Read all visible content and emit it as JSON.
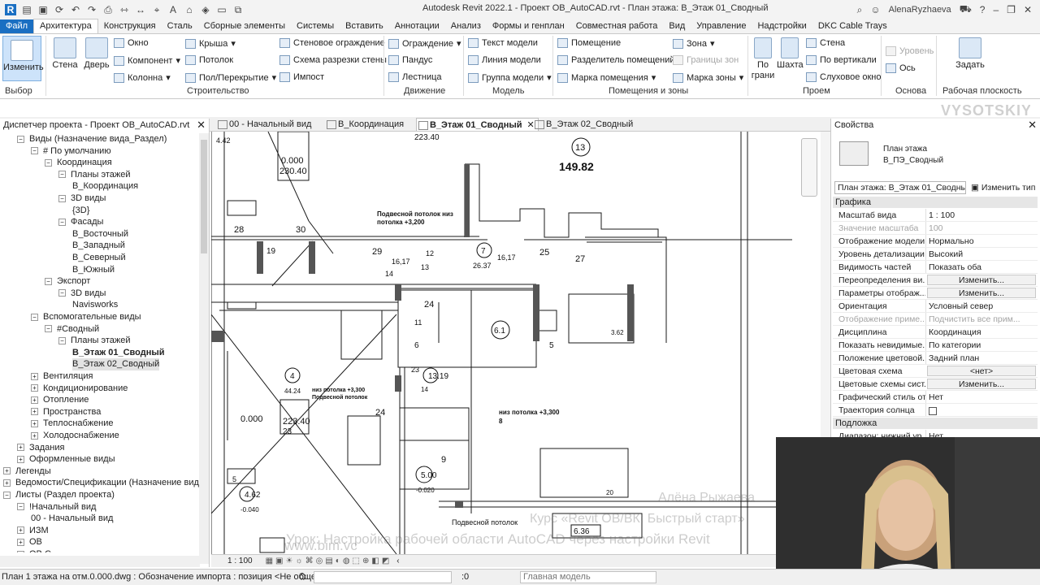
{
  "window": {
    "title": "Autodesk Revit 2022.1 - Проект OB_AutoCAD.rvt - План этажа: В_Этаж 01_Сводный",
    "user": "AlenaRyzhaeva"
  },
  "ribbon_tabs": [
    "Файл",
    "Архитектура",
    "Конструкция",
    "Сталь",
    "Сборные элементы",
    "Системы",
    "Вставить",
    "Аннотации",
    "Анализ",
    "Формы и генплан",
    "Совместная работа",
    "Вид",
    "Управление",
    "Надстройки",
    "DKC Cable Trays"
  ],
  "ribbon": {
    "modify": "Изменить",
    "select": "Выбор",
    "wall": "Стена",
    "door": "Дверь",
    "window": "Окно",
    "component": "Компонент",
    "column": "Колонна",
    "roof": "Крыша",
    "ceiling": "Потолок",
    "floor": "Пол/Перекрытие",
    "curtain_wall": "Стеновое ограждение",
    "curtain_grid": "Схема разрезки стены",
    "mullion": "Импост",
    "build": "Строительство",
    "railing": "Ограждение",
    "ramp": "Пандус",
    "stair": "Лестница",
    "circulation": "Движение",
    "model_text": "Текст модели",
    "model_line": "Линия модели",
    "model_group": "Группа модели",
    "model": "Модель",
    "room": "Помещение",
    "room_separator": "Разделитель помещений",
    "room_tag": "Марка помещения",
    "area": "Зона",
    "area_boundary": "Границы зон",
    "area_tag": "Марка зоны",
    "rooms_areas": "Помещения и зоны",
    "by_face": "По грани",
    "shaft": "Шахта",
    "opening_wall": "Стена",
    "vertical": "По вертикали",
    "dormer": "Слуховое окно",
    "opening": "Проем",
    "level": "Уровень",
    "grid": "Ось",
    "datum": "Основа",
    "set": "Задать",
    "work_plane": "Рабочая плоскость"
  },
  "view_tabs": [
    "00 - Начальный вид",
    "В_Координация",
    "В_Этаж 01_Сводный",
    "В_Этаж 02_Сводный"
  ],
  "project_browser": {
    "title": "Диспетчер проекта - Проект OB_AutoCAD.rvt",
    "items": [
      {
        "label": "Виды (Назначение вида_Раздел)",
        "indent": 1,
        "toggle": "−"
      },
      {
        "label": "# По умолчанию",
        "indent": 2,
        "toggle": "−"
      },
      {
        "label": "Координация",
        "indent": 3,
        "toggle": "−"
      },
      {
        "label": "Планы этажей",
        "indent": 4,
        "toggle": "−"
      },
      {
        "label": "В_Координация",
        "indent": 5,
        "toggle": ""
      },
      {
        "label": "3D виды",
        "indent": 4,
        "toggle": "−"
      },
      {
        "label": "{3D}",
        "indent": 5,
        "toggle": ""
      },
      {
        "label": "Фасады",
        "indent": 4,
        "toggle": "−"
      },
      {
        "label": "В_Восточный",
        "indent": 5,
        "toggle": ""
      },
      {
        "label": "В_Западный",
        "indent": 5,
        "toggle": ""
      },
      {
        "label": "В_Северный",
        "indent": 5,
        "toggle": ""
      },
      {
        "label": "В_Южный",
        "indent": 5,
        "toggle": ""
      },
      {
        "label": "Экспорт",
        "indent": 3,
        "toggle": "−"
      },
      {
        "label": "3D виды",
        "indent": 4,
        "toggle": "−"
      },
      {
        "label": "Navisworks",
        "indent": 5,
        "toggle": ""
      },
      {
        "label": "Вспомогательные виды",
        "indent": 2,
        "toggle": "−"
      },
      {
        "label": "#Сводный",
        "indent": 3,
        "toggle": "−"
      },
      {
        "label": "Планы этажей",
        "indent": 4,
        "toggle": "−"
      },
      {
        "label": "В_Этаж 01_Сводный",
        "indent": 5,
        "toggle": "",
        "bold": true
      },
      {
        "label": "В_Этаж 02_Сводный",
        "indent": 5,
        "toggle": "",
        "hl": true
      },
      {
        "label": "Вентиляция",
        "indent": 2,
        "toggle": "+"
      },
      {
        "label": "Кондиционирование",
        "indent": 2,
        "toggle": "+"
      },
      {
        "label": "Отопление",
        "indent": 2,
        "toggle": "+"
      },
      {
        "label": "Пространства",
        "indent": 2,
        "toggle": "+"
      },
      {
        "label": "Теплоснабжение",
        "indent": 2,
        "toggle": "+"
      },
      {
        "label": "Холодоснабжение",
        "indent": 2,
        "toggle": "+"
      },
      {
        "label": "Задания",
        "indent": 1,
        "toggle": "+"
      },
      {
        "label": "Оформленные виды",
        "indent": 1,
        "toggle": "+"
      },
      {
        "label": "Легенды",
        "indent": 0,
        "toggle": "+"
      },
      {
        "label": "Ведомости/Спецификации (Назначение вид",
        "indent": 0,
        "toggle": "+"
      },
      {
        "label": "Листы (Раздел проекта)",
        "indent": 0,
        "toggle": "−"
      },
      {
        "label": "!Начальный вид",
        "indent": 1,
        "toggle": "−"
      },
      {
        "label": "00 - Начальный вид",
        "indent": 2,
        "toggle": ""
      },
      {
        "label": "ИЗМ",
        "indent": 1,
        "toggle": "+"
      },
      {
        "label": "ОВ",
        "indent": 1,
        "toggle": "+"
      },
      {
        "label": "ОВ С",
        "indent": 1,
        "toggle": "+"
      }
    ]
  },
  "drawing": {
    "labels": [
      {
        "t": "13"
      },
      {
        "t": "149.82"
      },
      {
        "t": "0.000"
      },
      {
        "t": "230.40"
      },
      {
        "t": "223.40"
      },
      {
        "t": "4.42"
      },
      {
        "t": "Подвесной потолок низ"
      },
      {
        "t": "потолка +3,200"
      },
      {
        "t": "28"
      },
      {
        "t": "30"
      },
      {
        "t": "19"
      },
      {
        "t": "29"
      },
      {
        "t": "16,17"
      },
      {
        "t": "12"
      },
      {
        "t": "7"
      },
      {
        "t": "26.37"
      },
      {
        "t": "25"
      },
      {
        "t": "27"
      },
      {
        "t": "16,17"
      },
      {
        "t": "13"
      },
      {
        "t": "24"
      },
      {
        "t": "11"
      },
      {
        "t": "6.1"
      },
      {
        "t": "5"
      },
      {
        "t": "3.62"
      },
      {
        "t": "4"
      },
      {
        "t": "44.24"
      },
      {
        "t": "6"
      },
      {
        "t": "13.19"
      },
      {
        "t": "14"
      },
      {
        "t": "23"
      },
      {
        "t": "0.000"
      },
      {
        "t": "223.40"
      },
      {
        "t": "23"
      },
      {
        "t": "24"
      },
      {
        "t": "9"
      },
      {
        "t": "5.00"
      },
      {
        "t": "-0.020"
      },
      {
        "t": "5"
      },
      {
        "t": "4.62"
      },
      {
        "t": "-0.040"
      },
      {
        "t": "6.36"
      },
      {
        "t": "20"
      },
      {
        "t": "Подвесной потолок"
      },
      {
        "t": "низ потолка +3,300"
      },
      {
        "t": "Подвесной потолок"
      },
      {
        "t": "низ потолка +3,300"
      },
      {
        "t": "8"
      },
      {
        "t": "14"
      }
    ]
  },
  "view_bar": {
    "scale": "1 : 100"
  },
  "properties": {
    "title": "Свойства",
    "type_line1": "План этажа",
    "type_line2": "В_ПЭ_Сводный",
    "selector": "План этажа: В_Этаж 01_Сводный",
    "edit_type": "Изменить тип",
    "group_graphics": "Графика",
    "group_underlay": "Подложка",
    "rows": [
      {
        "k": "Масштаб вида",
        "v": "1 : 100"
      },
      {
        "k": "Значение масштаба",
        "v": "100",
        "dis": true
      },
      {
        "k": "Отображение модели",
        "v": "Нормально"
      },
      {
        "k": "Уровень детализации",
        "v": "Высокий"
      },
      {
        "k": "Видимость частей",
        "v": "Показать оба"
      },
      {
        "k": "Переопределения ви...",
        "v": "Изменить...",
        "btn": true
      },
      {
        "k": "Параметры отображ...",
        "v": "Изменить...",
        "btn": true
      },
      {
        "k": "Ориентация",
        "v": "Условный север"
      },
      {
        "k": "Отображение приме...",
        "v": "Подчистить все прим...",
        "dis": true
      },
      {
        "k": "Дисциплина",
        "v": "Координация"
      },
      {
        "k": "Показать невидимые...",
        "v": "По категории"
      },
      {
        "k": "Положение цветовой...",
        "v": "Задний план"
      },
      {
        "k": "Цветовая схема",
        "v": "<нет>",
        "btn": true
      },
      {
        "k": "Цветовые схемы сист...",
        "v": "Изменить...",
        "btn": true
      },
      {
        "k": "Графический стиль от...",
        "v": "Нет"
      },
      {
        "k": "Траектория солнца",
        "v": "",
        "chk": true
      }
    ],
    "underlay_row": {
      "k": "Диапазон: нижний ур...",
      "v": "Нет"
    }
  },
  "status": {
    "text": "План 1 этажа на отм.0.000.dwg : Обозначение импорта : позиция <Не общедо",
    "zero": ":0",
    "model": "Главная модель"
  },
  "watermarks": {
    "site": "www.bim.vc",
    "author": "Алёна Рыжаева",
    "course": "Курс «Revit ОВ/ВК: Быстрый старт»",
    "lesson": "Урок: Настройка рабочей области AutoCAD через настройки Revit",
    "logo": "VYSOTSKIY"
  },
  "colors": {
    "accent": "#1a6fc2",
    "drawing_line": "#1a1a1a"
  }
}
